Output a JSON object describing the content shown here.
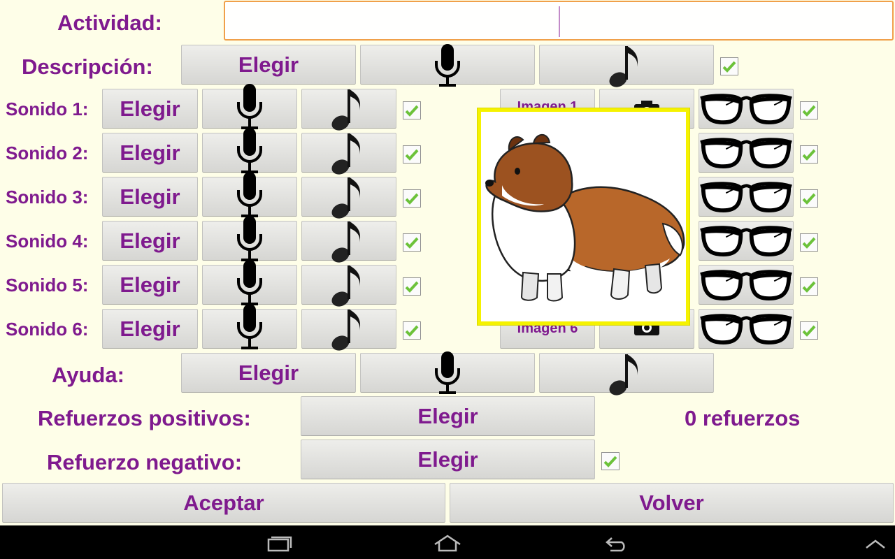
{
  "activity": {
    "label": "Actividad:",
    "value": ""
  },
  "description": {
    "label": "Descripción:",
    "choose_label": "Elegir"
  },
  "sounds": [
    {
      "label": "Sonido 1:",
      "choose_label": "Elegir"
    },
    {
      "label": "Sonido 2:",
      "choose_label": "Elegir"
    },
    {
      "label": "Sonido 3:",
      "choose_label": "Elegir"
    },
    {
      "label": "Sonido 4:",
      "choose_label": "Elegir"
    },
    {
      "label": "Sonido 5:",
      "choose_label": "Elegir"
    },
    {
      "label": "Sonido 6:",
      "choose_label": "Elegir"
    }
  ],
  "images": [
    {
      "label": "Imagen 1"
    },
    {
      "label": "Imagen 6"
    }
  ],
  "help": {
    "label": "Ayuda:",
    "choose_label": "Elegir"
  },
  "positive_reinforcement": {
    "label": "Refuerzos positivos:",
    "choose_label": "Elegir",
    "count_text": "0 refuerzos"
  },
  "negative_reinforcement": {
    "label": "Refuerzo negativo:",
    "choose_label": "Elegir"
  },
  "actions": {
    "accept_label": "Aceptar",
    "back_label": "Volver"
  },
  "popup": {
    "image": "sheltie-dog-illustration"
  },
  "colors": {
    "accent_text": "#7f1a8e",
    "background": "#fefee8",
    "input_border": "#f0a04a",
    "popup_border": "#f5f200",
    "check": "#6cc23a"
  }
}
